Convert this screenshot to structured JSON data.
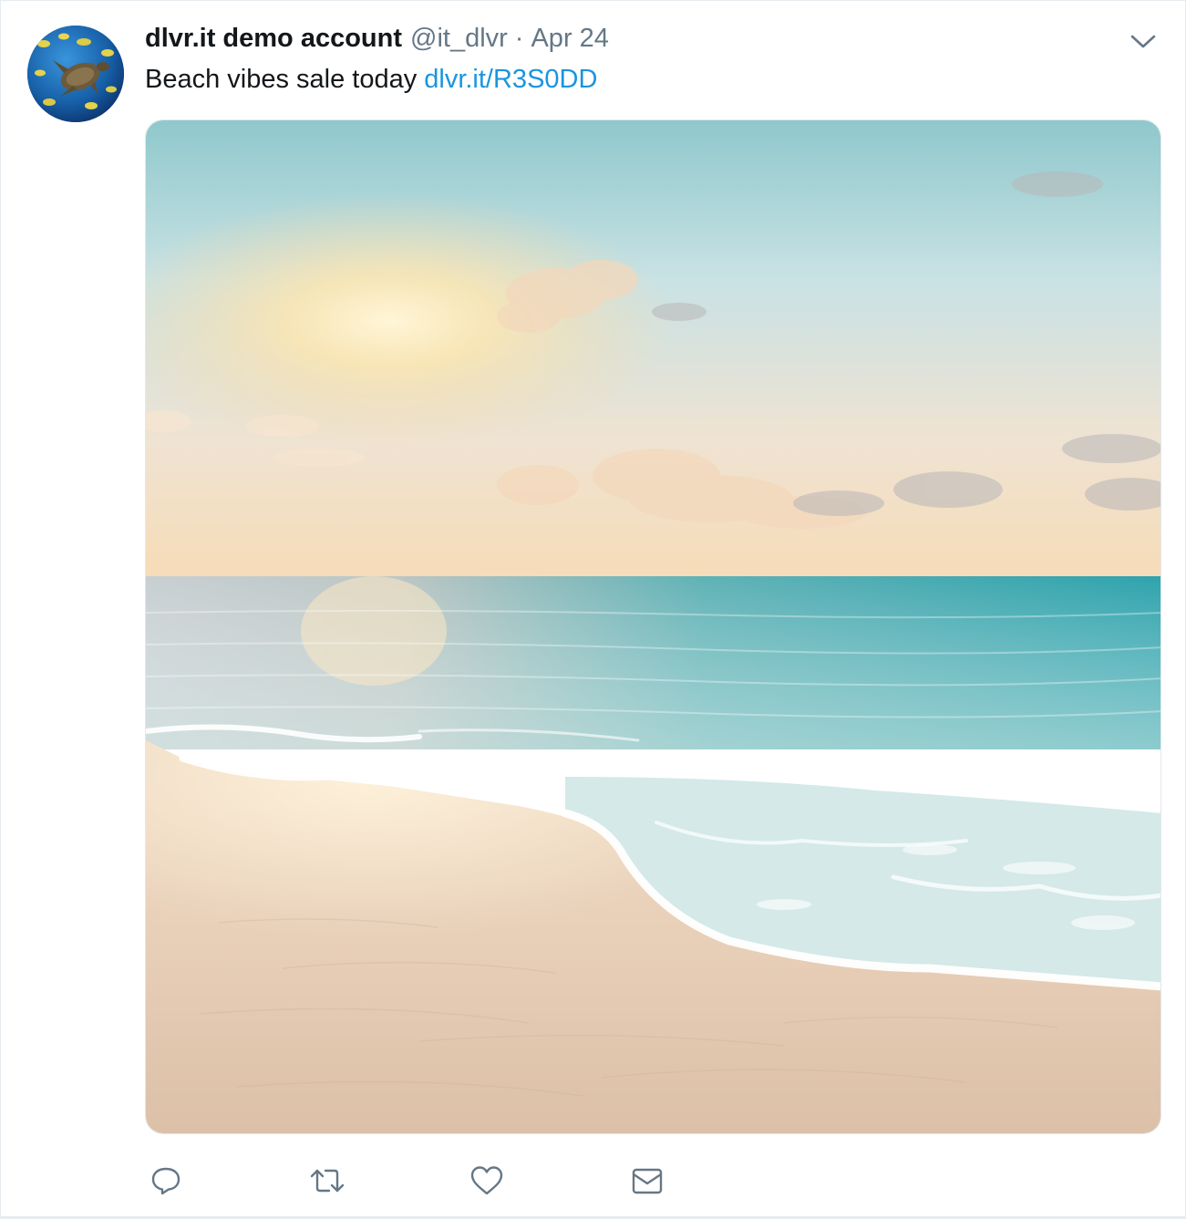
{
  "tweet": {
    "author": {
      "display_name": "dlvr.it demo account",
      "handle": "@it_dlvr",
      "avatar_icon": "sea-turtle-avatar"
    },
    "separator": "·",
    "timestamp": "Apr 24",
    "text": "Beach vibes sale today",
    "link": "dlvr.it/R3S0DD",
    "media": {
      "description_icon": "beach-sunset-photo"
    },
    "actions": [
      {
        "name": "reply",
        "icon": "reply-icon"
      },
      {
        "name": "retweet",
        "icon": "retweet-icon"
      },
      {
        "name": "like",
        "icon": "heart-icon"
      },
      {
        "name": "direct-message",
        "icon": "envelope-icon"
      }
    ]
  },
  "colors": {
    "text_primary": "#14171a",
    "text_secondary": "#657786",
    "link": "#1b95e0",
    "border": "#e6ecf0",
    "icon": "#657786"
  }
}
